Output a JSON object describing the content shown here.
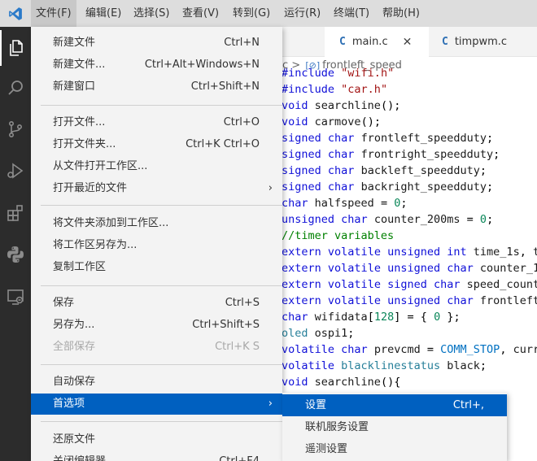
{
  "menubar": {
    "items": [
      "文件(F)",
      "编辑(E)",
      "选择(S)",
      "查看(V)",
      "转到(G)",
      "运行(R)",
      "终端(T)",
      "帮助(H)"
    ]
  },
  "activity": {
    "icons": [
      "explorer-icon",
      "search-icon",
      "source-control-icon",
      "run-debug-icon",
      "extensions-icon",
      "python-icon",
      "remote-explorer-icon"
    ]
  },
  "editor": {
    "tabs": [
      {
        "icon": "C",
        "label": "main.c",
        "close": "✕"
      },
      {
        "icon": "C",
        "label": "timpwm.c"
      }
    ],
    "breadcrumb": {
      "file": "c",
      "sep": ">",
      "symbol_icon": "[⊘]",
      "symbol": "frontleft_speed"
    },
    "code_lines": [
      "#include \"wifi.h\"",
      "#include \"car.h\"",
      "void searchline();",
      "void carmove();",
      "signed char frontleft_speedduty;",
      "signed char frontright_speedduty;",
      "signed char backleft_speedduty;",
      "signed char backright_speedduty;",
      "char halfspeed = 0;",
      "unsigned char counter_200ms = 0;",
      "//timer variables",
      "extern volatile unsigned int time_1s, t",
      "extern volatile unsigned char counter_1",
      "extern volatile signed char speed_count",
      "extern volatile unsigned char frontleft",
      "char wifidata[128] = { 0 };",
      "oled ospi1;",
      "volatile char prevcmd = COMM_STOP, curr",
      "volatile blacklinestatus black;",
      "void searchline(){"
    ]
  },
  "file_menu": {
    "items": [
      {
        "label": "新建文件",
        "shortcut": "Ctrl+N"
      },
      {
        "label": "新建文件...",
        "shortcut": "Ctrl+Alt+Windows+N"
      },
      {
        "label": "新建窗口",
        "shortcut": "Ctrl+Shift+N"
      },
      {
        "label": "打开文件...",
        "shortcut": "Ctrl+O"
      },
      {
        "label": "打开文件夹...",
        "shortcut": "Ctrl+K Ctrl+O"
      },
      {
        "label": "从文件打开工作区...",
        "shortcut": ""
      },
      {
        "label": "打开最近的文件",
        "shortcut": "",
        "arrow": "›"
      },
      {
        "label": "将文件夹添加到工作区...",
        "shortcut": ""
      },
      {
        "label": "将工作区另存为...",
        "shortcut": ""
      },
      {
        "label": "复制工作区",
        "shortcut": ""
      },
      {
        "label": "保存",
        "shortcut": "Ctrl+S"
      },
      {
        "label": "另存为...",
        "shortcut": "Ctrl+Shift+S"
      },
      {
        "label": "全部保存",
        "shortcut": "Ctrl+K S",
        "disabled": true
      },
      {
        "label": "自动保存",
        "shortcut": ""
      },
      {
        "label": "首选项",
        "shortcut": "",
        "arrow": "›",
        "selected": true
      },
      {
        "label": "还原文件",
        "shortcut": ""
      },
      {
        "label": "关闭编辑器",
        "shortcut": "Ctrl+F4"
      }
    ]
  },
  "preferences_submenu": {
    "items": [
      {
        "label": "设置",
        "shortcut": "Ctrl+,",
        "selected": true
      },
      {
        "label": "联机服务设置",
        "shortcut": ""
      },
      {
        "label": "遥测设置",
        "shortcut": ""
      }
    ]
  },
  "colors": {
    "menubar_bg": "#dddddd",
    "activitybar_bg": "#2c2c2c",
    "menu_bg": "#f3f3f3",
    "selection": "#0060c0",
    "keyword": "#1010d8",
    "string": "#a31515",
    "comment": "#008000",
    "number": "#098658",
    "type": "#267f99",
    "macro": "#0070c1"
  }
}
